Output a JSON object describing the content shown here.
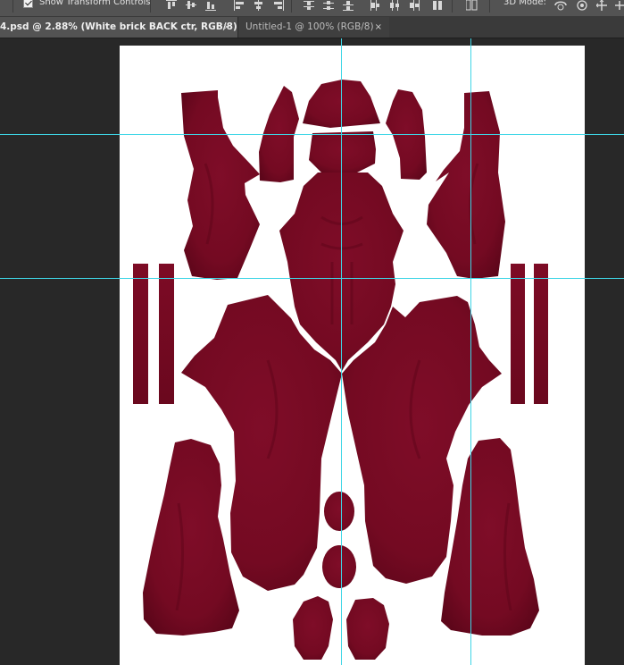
{
  "options_bar": {
    "show_transform_label": "Show Transform Controls",
    "show_transform_checked": true,
    "mode_label": "3D Mode:"
  },
  "tabs": [
    {
      "title": "4.psd @ 2.88% (White brick BACK ctr, RGB/8) *",
      "active": true,
      "close": "×"
    },
    {
      "title": "Untitled-1 @ 100% (RGB/8)",
      "active": false,
      "close": "×"
    }
  ],
  "colors": {
    "workspace": "#282828",
    "document": "#ffffff",
    "fabric": "#7c0a24",
    "guide": "#3fd6e6"
  },
  "document": {
    "content": "dark red bodysuit UV pattern pieces on white background"
  }
}
